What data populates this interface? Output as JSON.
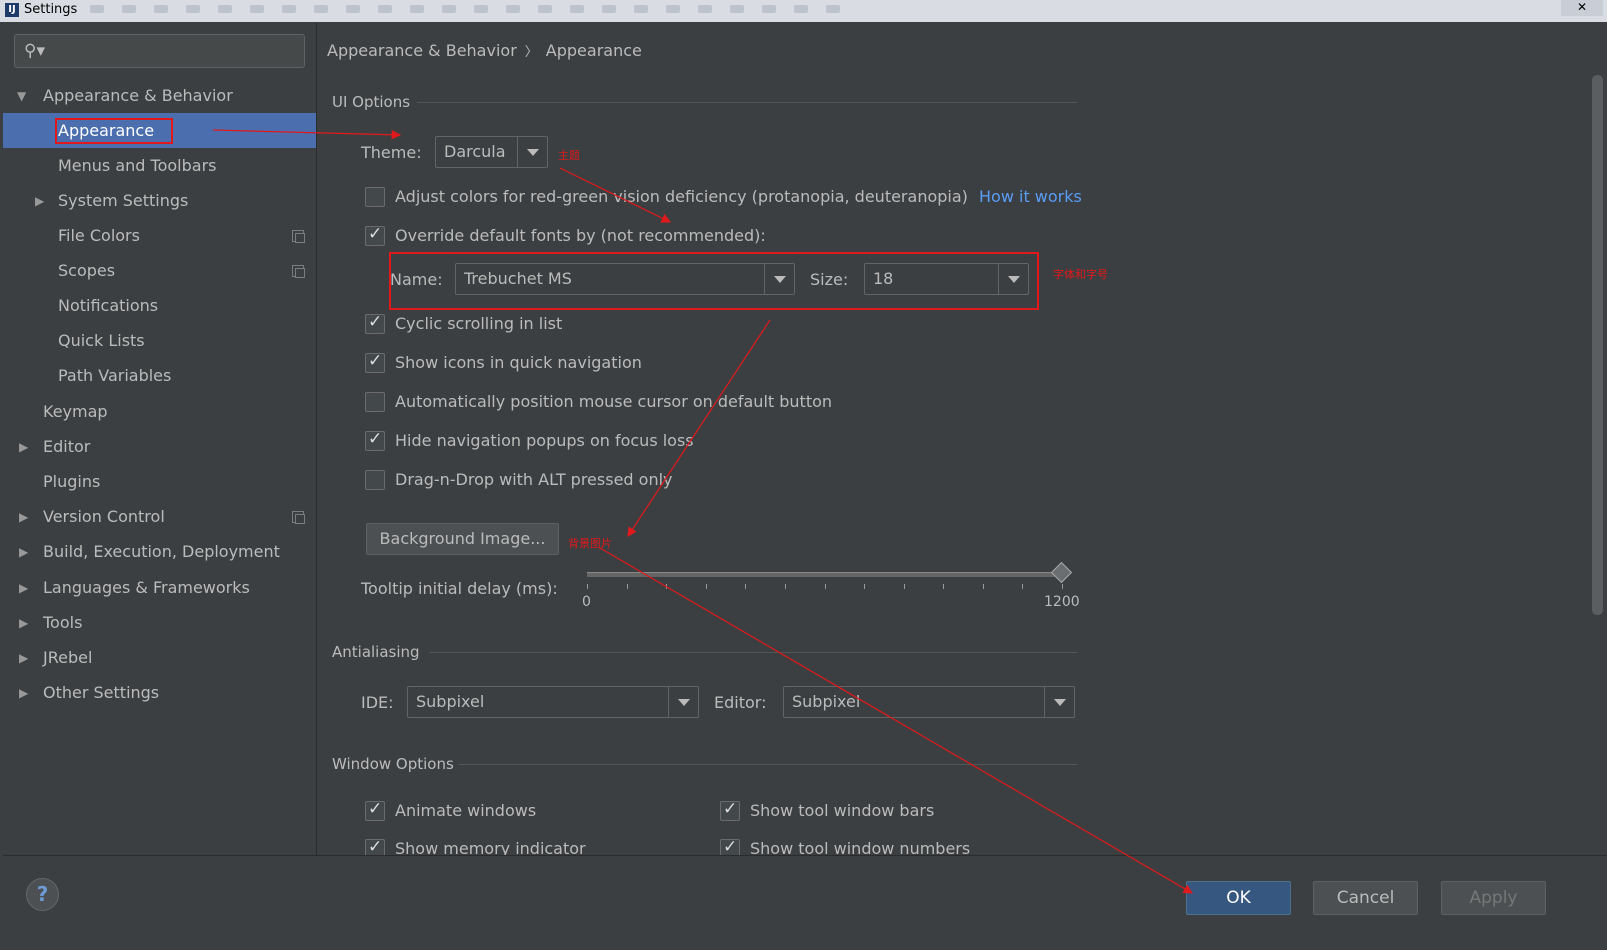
{
  "window": {
    "title": "Settings",
    "close_glyph": "✕"
  },
  "search": {
    "placeholder": "",
    "icon": "search-icon"
  },
  "sidebar": {
    "items": [
      {
        "label": "Appearance & Behavior",
        "level": 0,
        "expanded": true,
        "has_children": true
      },
      {
        "label": "Appearance",
        "level": 1,
        "selected": true
      },
      {
        "label": "Menus and Toolbars",
        "level": 1
      },
      {
        "label": "System Settings",
        "level": 1,
        "has_children": true
      },
      {
        "label": "File Colors",
        "level": 1,
        "project_icon": true
      },
      {
        "label": "Scopes",
        "level": 1,
        "project_icon": true
      },
      {
        "label": "Notifications",
        "level": 1
      },
      {
        "label": "Quick Lists",
        "level": 1
      },
      {
        "label": "Path Variables",
        "level": 1
      },
      {
        "label": "Keymap",
        "level": 0
      },
      {
        "label": "Editor",
        "level": 0,
        "has_children": true
      },
      {
        "label": "Plugins",
        "level": 0
      },
      {
        "label": "Version Control",
        "level": 0,
        "has_children": true,
        "project_icon": true
      },
      {
        "label": "Build, Execution, Deployment",
        "level": 0,
        "has_children": true
      },
      {
        "label": "Languages & Frameworks",
        "level": 0,
        "has_children": true
      },
      {
        "label": "Tools",
        "level": 0,
        "has_children": true
      },
      {
        "label": "JRebel",
        "level": 0,
        "has_children": true
      },
      {
        "label": "Other Settings",
        "level": 0,
        "has_children": true
      }
    ]
  },
  "breadcrumb": {
    "parent": "Appearance & Behavior",
    "separator": "〉",
    "current": "Appearance"
  },
  "ui_options": {
    "section_title": "UI Options",
    "theme_label": "Theme:",
    "theme_value": "Darcula",
    "adjust_colors": {
      "label": "Adjust colors for red-green vision deficiency (protanopia, deuteranopia)",
      "checked": false
    },
    "how_it_works": "How it works",
    "override_fonts": {
      "label": "Override default fonts by (not recommended):",
      "checked": true
    },
    "font_name_label": "Name:",
    "font_name_value": "Trebuchet MS",
    "font_size_label": "Size:",
    "font_size_value": "18",
    "cyclic_scrolling": {
      "label": "Cyclic scrolling in list",
      "checked": true
    },
    "show_icons": {
      "label": "Show icons in quick navigation",
      "checked": true
    },
    "auto_position": {
      "label": "Automatically position mouse cursor on default button",
      "checked": false
    },
    "hide_popups": {
      "label": "Hide navigation popups on focus loss",
      "checked": true
    },
    "drag_drop": {
      "label": "Drag-n-Drop with ALT pressed only",
      "checked": false
    },
    "background_image": "Background Image...",
    "tooltip_label": "Tooltip initial delay (ms):",
    "tooltip_min": "0",
    "tooltip_max": "1200",
    "tooltip_value": 1200
  },
  "antialiasing": {
    "section_title": "Antialiasing",
    "ide_label": "IDE:",
    "ide_value": "Subpixel",
    "editor_label": "Editor:",
    "editor_value": "Subpixel"
  },
  "window_options": {
    "section_title": "Window Options",
    "animate_windows": {
      "label": "Animate windows",
      "checked": true
    },
    "show_tool_window_bars": {
      "label": "Show tool window bars",
      "checked": true
    },
    "show_memory_indicator": {
      "label": "Show memory indicator",
      "checked": true
    },
    "show_tool_window_numbers": {
      "label": "Show tool window numbers",
      "checked": true
    }
  },
  "annotations": {
    "theme_note": "主题",
    "font_note": "字体和字号",
    "bg_note": "背景图片",
    "color": "#e0191c"
  },
  "footer": {
    "help": "?",
    "ok": "OK",
    "cancel": "Cancel",
    "apply": "Apply"
  },
  "colors": {
    "background": "#3c3f41",
    "selection": "#4b6eaf",
    "link": "#589df6",
    "primary_button": "#365880"
  }
}
